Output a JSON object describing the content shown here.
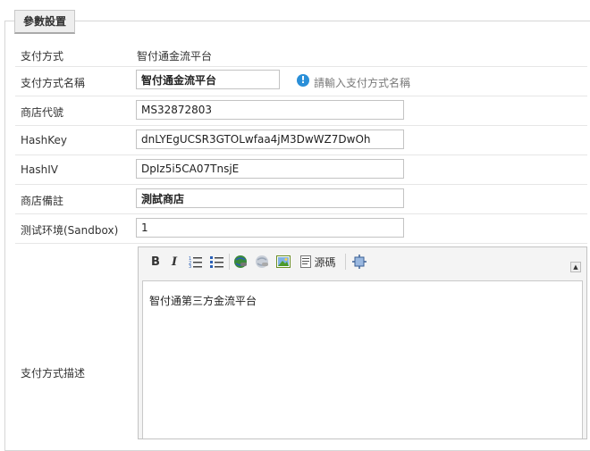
{
  "section": {
    "title": "參數設置"
  },
  "fields": {
    "payment_method": {
      "label": "支付方式",
      "value": "智付通金流平台"
    },
    "payment_method_name": {
      "label": "支付方式名稱",
      "value": "智付通金流平台",
      "hint": "請輸入支付方式名稱"
    },
    "store_code": {
      "label": "商店代號",
      "value": "MS32872803"
    },
    "hash_key": {
      "label": "HashKey",
      "value": "dnLYEgUCSR3GTOLwfaa4jM3DwWZ7DwOh"
    },
    "hash_iv": {
      "label": "HashIV",
      "value": "DpIz5i5CA07TnsjE"
    },
    "store_note": {
      "label": "商店備註",
      "value": "測試商店"
    },
    "sandbox": {
      "label": "测试环境(Sandbox)",
      "value": "1"
    },
    "description": {
      "label": "支付方式描述",
      "content": "智付通第三方金流平台"
    }
  },
  "editor": {
    "toolbar": {
      "bold": "B",
      "italic": "I",
      "source_label": "源碼"
    },
    "icons": [
      "bold-icon",
      "italic-icon",
      "ordered-list-icon",
      "unordered-list-icon",
      "link-icon",
      "unlink-icon",
      "image-icon",
      "source-icon",
      "maximize-icon"
    ]
  },
  "colors": {
    "info": "#2a8fd8",
    "border": "#c3c3c3"
  }
}
